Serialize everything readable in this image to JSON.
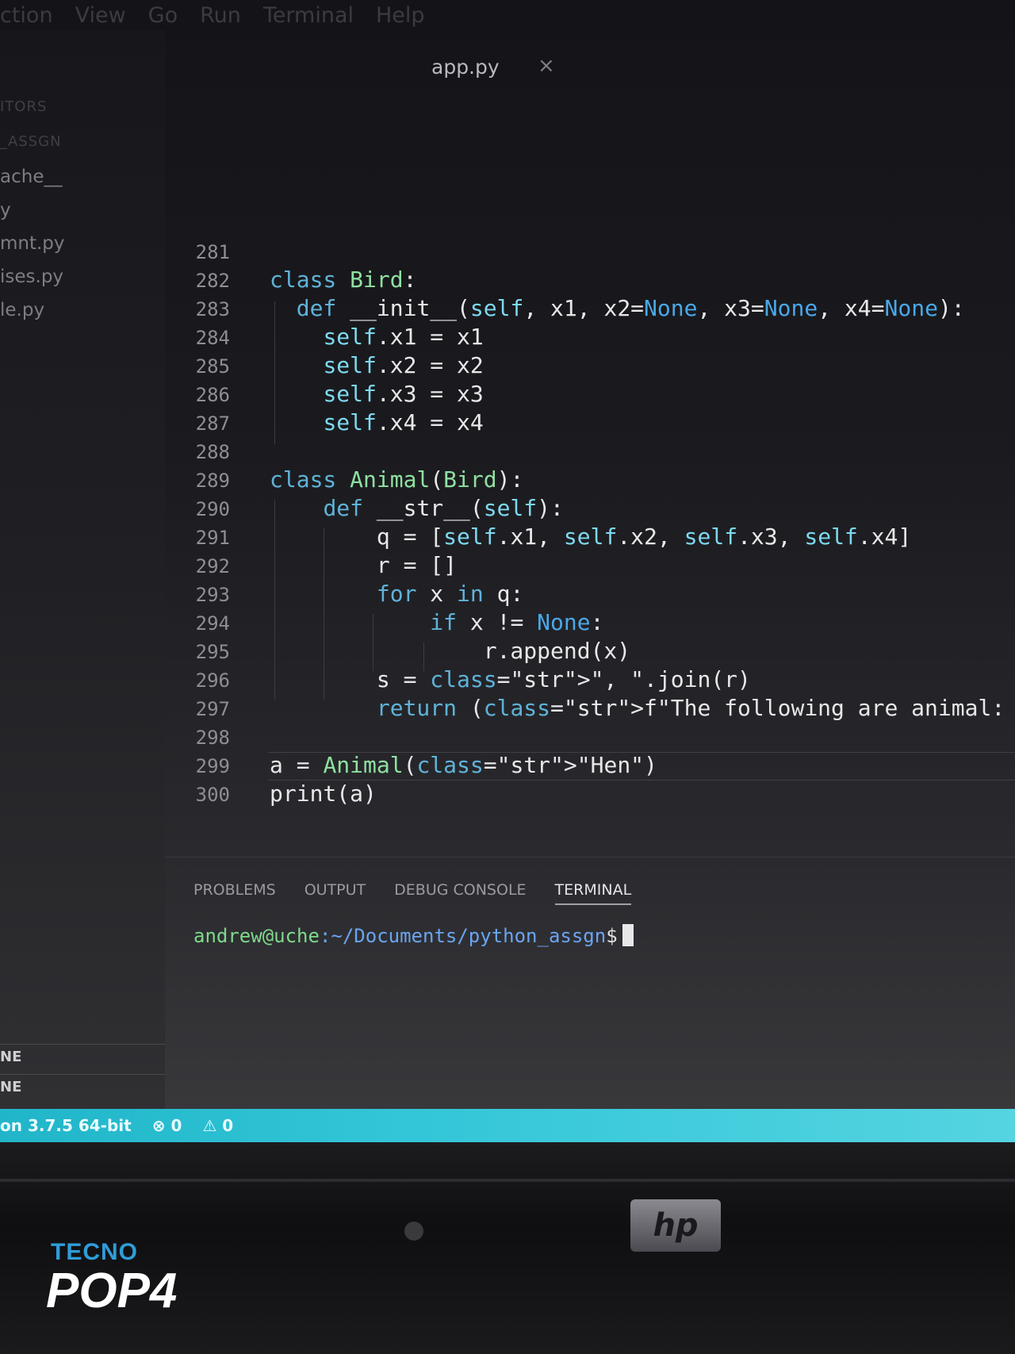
{
  "menu": [
    "ction",
    "View",
    "Go",
    "Run",
    "Terminal",
    "Help"
  ],
  "tab": {
    "title": "app.py",
    "close": "×"
  },
  "sidebar": {
    "section": "ITORS",
    "folder": "_ASSGN",
    "files": [
      "ache__",
      "y",
      "mnt.py",
      "ises.py",
      "le.py"
    ],
    "footer": [
      "NE",
      "NE"
    ]
  },
  "editor": {
    "lines": [
      {
        "n": "281",
        "code": ""
      },
      {
        "n": "282",
        "code": "class Bird:"
      },
      {
        "n": "283",
        "code": "  def __init__(self, x1, x2=None, x3=None, x4=None):"
      },
      {
        "n": "284",
        "code": "    self.x1 = x1"
      },
      {
        "n": "285",
        "code": "    self.x2 = x2"
      },
      {
        "n": "286",
        "code": "    self.x3 = x3"
      },
      {
        "n": "287",
        "code": "    self.x4 = x4"
      },
      {
        "n": "288",
        "code": ""
      },
      {
        "n": "289",
        "code": "class Animal(Bird):"
      },
      {
        "n": "290",
        "code": "    def __str__(self):"
      },
      {
        "n": "291",
        "code": "        q = [self.x1, self.x2, self.x3, self.x4]"
      },
      {
        "n": "292",
        "code": "        r = []"
      },
      {
        "n": "293",
        "code": "        for x in q:"
      },
      {
        "n": "294",
        "code": "            if x != None:"
      },
      {
        "n": "295",
        "code": "                r.append(x)"
      },
      {
        "n": "296",
        "code": "        s = \", \".join(r)"
      },
      {
        "n": "297",
        "code": "        return (f\"The following are animal: {s}\")"
      },
      {
        "n": "298",
        "code": ""
      },
      {
        "n": "299",
        "code": "a = Animal(\"Hen\")"
      },
      {
        "n": "300",
        "code": "print(a)"
      }
    ]
  },
  "panel": {
    "tabs": [
      "PROBLEMS",
      "OUTPUT",
      "DEBUG CONSOLE",
      "TERMINAL"
    ],
    "active_tab": "TERMINAL",
    "prompt_user": "andrew@uche",
    "prompt_path": ":~/Documents/python_assgn",
    "prompt_symbol": "$"
  },
  "status": {
    "python": "on 3.7.5 64-bit",
    "errors": "⊗ 0",
    "warnings": "⚠ 0"
  },
  "watermark": {
    "brand": "TECNO",
    "model": "POP4"
  },
  "colors": {
    "statusbar": "#32c6d8",
    "keyword": "#5fb3d9",
    "class": "#8fe0a0",
    "string": "#e6d892",
    "prompt_user": "#7fd98b",
    "prompt_path": "#6aa5f0"
  }
}
